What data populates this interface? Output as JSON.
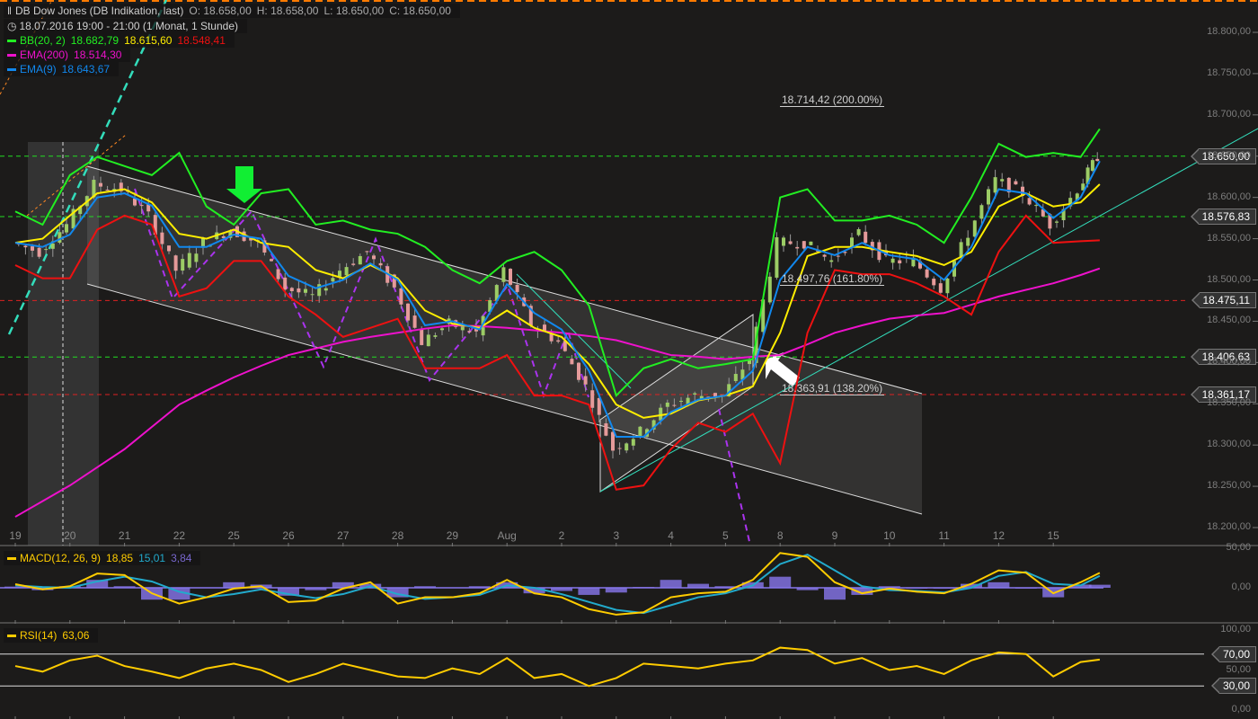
{
  "header": {
    "title": "DB Dow Jones (DB Indikation, last)",
    "ohlc": {
      "open": "O: 18.658,00",
      "high": "H: 18.658,00",
      "low": "L: 18.650,00",
      "close": "C: 18.650,00"
    },
    "period": "18.07.2016 19:00 - 21:00 (1 Monat, 1 Stunde)"
  },
  "indicators": {
    "bb": {
      "label": "BB(20, 2)",
      "upper": "18.682,79",
      "mid": "18.615,60",
      "lower": "18.548,41"
    },
    "ema200": {
      "label": "EMA(200)",
      "value": "18.514,30"
    },
    "ema9": {
      "label": "EMA(9)",
      "value": "18.643,67"
    },
    "macd": {
      "label": "MACD(12, 26, 9)",
      "macd": "18,85",
      "signal": "15,01",
      "hist": "3,84"
    },
    "rsi": {
      "label": "RSI(14)",
      "value": "63,06"
    }
  },
  "colors": {
    "bb_upper": "#22ee22",
    "bb_mid": "#ffee00",
    "bb_lower": "#ee1111",
    "ema200": "#ee11cc",
    "ema9": "#1188ee",
    "macd": "#ffcc00",
    "signal": "#22aacc",
    "hist": "#8877ee",
    "rsi": "#ffcc00",
    "up": "#9ccc65",
    "down": "#e59a9a"
  },
  "chart_data": {
    "type": "line",
    "title": "DB Dow Jones (DB Indikation, last) 1 Stunde",
    "x_unit": "trading day index (0 = 19 Jul)",
    "x": [
      0,
      0.5,
      1,
      1.5,
      2,
      2.5,
      3,
      3.5,
      4,
      4.5,
      5,
      5.5,
      6,
      6.5,
      7,
      7.5,
      8,
      8.5,
      9,
      9.5,
      10,
      10.5,
      11,
      11.5,
      12,
      12.5,
      13,
      13.5,
      14,
      14.5,
      15,
      15.5,
      16,
      16.5,
      17,
      17.5,
      18,
      18.5,
      19,
      19.5,
      19.85
    ],
    "x_ticks": [
      {
        "d": 0,
        "label": "19"
      },
      {
        "d": 1,
        "label": "20"
      },
      {
        "d": 2,
        "label": "21"
      },
      {
        "d": 3,
        "label": "22"
      },
      {
        "d": 4,
        "label": "25"
      },
      {
        "d": 5,
        "label": "26"
      },
      {
        "d": 6,
        "label": "27"
      },
      {
        "d": 7,
        "label": "28"
      },
      {
        "d": 8,
        "label": "29"
      },
      {
        "d": 9,
        "label": "Aug"
      },
      {
        "d": 10,
        "label": "2"
      },
      {
        "d": 11,
        "label": "3"
      },
      {
        "d": 12,
        "label": "4"
      },
      {
        "d": 13,
        "label": "5"
      },
      {
        "d": 14,
        "label": "8"
      },
      {
        "d": 15,
        "label": "9"
      },
      {
        "d": 16,
        "label": "10"
      },
      {
        "d": 17,
        "label": "11"
      },
      {
        "d": 18,
        "label": "12"
      },
      {
        "d": 19,
        "label": "15"
      }
    ],
    "price": {
      "ylim": [
        18200,
        18800
      ],
      "y_ticks": [
        "18.800,00",
        "18.750,00",
        "18.700,00",
        "18.650,00",
        "18.600,00",
        "18.550,00",
        "18.500,00",
        "18.450,00",
        "18.400,00",
        "18.350,00",
        "18.300,00",
        "18.250,00",
        "18.200,00"
      ],
      "y_tick_values": [
        18800,
        18750,
        18700,
        18650,
        18600,
        18550,
        18500,
        18450,
        18400,
        18350,
        18300,
        18250,
        18200
      ],
      "close": [
        18545,
        18534,
        18567,
        18616,
        18610,
        18578,
        18512,
        18545,
        18561,
        18545,
        18490,
        18480,
        18512,
        18534,
        18490,
        18425,
        18447,
        18436,
        18512,
        18447,
        18425,
        18371,
        18295,
        18316,
        18349,
        18360,
        18360,
        18404,
        18545,
        18545,
        18523,
        18556,
        18523,
        18523,
        18490,
        18556,
        18621,
        18605,
        18567,
        18610,
        18650
      ],
      "bb_upper": [
        18583,
        18567,
        18627,
        18649,
        18638,
        18627,
        18654,
        18589,
        18567,
        18605,
        18610,
        18567,
        18572,
        18561,
        18556,
        18540,
        18512,
        18496,
        18523,
        18534,
        18512,
        18469,
        18360,
        18393,
        18404,
        18393,
        18398,
        18404,
        18600,
        18610,
        18572,
        18572,
        18578,
        18567,
        18545,
        18600,
        18665,
        18649,
        18654,
        18649,
        18683
      ],
      "bb_mid": [
        18545,
        18550,
        18578,
        18605,
        18610,
        18594,
        18556,
        18550,
        18561,
        18545,
        18540,
        18512,
        18502,
        18518,
        18502,
        18463,
        18447,
        18442,
        18463,
        18442,
        18431,
        18398,
        18349,
        18333,
        18338,
        18354,
        18360,
        18371,
        18436,
        18529,
        18540,
        18540,
        18534,
        18529,
        18518,
        18534,
        18589,
        18605,
        18589,
        18594,
        18616
      ],
      "bb_lower": [
        18518,
        18502,
        18502,
        18561,
        18578,
        18567,
        18480,
        18490,
        18523,
        18523,
        18480,
        18458,
        18431,
        18442,
        18453,
        18393,
        18393,
        18393,
        18409,
        18360,
        18360,
        18349,
        18246,
        18251,
        18295,
        18327,
        18316,
        18338,
        18278,
        18436,
        18512,
        18507,
        18507,
        18496,
        18480,
        18458,
        18534,
        18578,
        18545,
        18547,
        18548
      ],
      "ema200": [
        18213,
        18232,
        18251,
        18273,
        18295,
        18322,
        18349,
        18366,
        18382,
        18396,
        18409,
        18417,
        18425,
        18431,
        18436,
        18441,
        18445,
        18444,
        18442,
        18439,
        18436,
        18432,
        18427,
        18418,
        18409,
        18407,
        18404,
        18407,
        18409,
        18422,
        18436,
        18445,
        18453,
        18457,
        18460,
        18470,
        18480,
        18488,
        18496,
        18506,
        18514
      ],
      "ema9": [
        18545,
        18540,
        18555,
        18600,
        18605,
        18590,
        18540,
        18540,
        18555,
        18550,
        18505,
        18490,
        18500,
        18520,
        18500,
        18445,
        18450,
        18440,
        18495,
        18460,
        18440,
        18390,
        18310,
        18310,
        18340,
        18355,
        18360,
        18390,
        18500,
        18540,
        18530,
        18545,
        18530,
        18525,
        18500,
        18540,
        18610,
        18605,
        18575,
        18600,
        18644
      ],
      "price_markers": [
        {
          "value": 18650.0,
          "label": "18.650,00",
          "style": "green-dashed"
        },
        {
          "value": 18576.83,
          "label": "18.576,83",
          "style": "green-dashed"
        },
        {
          "value": 18475.11,
          "label": "18.475,11",
          "style": "red-dashed"
        },
        {
          "value": 18406.63,
          "label": "18.406,63",
          "style": "green-dashed"
        },
        {
          "value": 18361.17,
          "label": "18.361,17",
          "style": "red-dashed"
        }
      ],
      "fib_labels": [
        {
          "value": 18714.42,
          "label": "18.714,42 (200.00%)"
        },
        {
          "value": 18497.76,
          "label": "18.497,76 (161.80%)"
        },
        {
          "value": 18363.91,
          "label": "18.363,91 (138.20%)"
        }
      ]
    },
    "macd_panel": {
      "ylim": [
        -40,
        55
      ],
      "y_ticks": [
        "50,00",
        "0,00"
      ],
      "y_tick_values": [
        50,
        0
      ],
      "macd": [
        4.5,
        -2,
        2,
        18,
        16,
        -7,
        -20,
        -12,
        -1,
        2,
        -18,
        -16,
        -1,
        7,
        -20,
        -12,
        -12,
        -7,
        10,
        -7,
        -12,
        -27,
        -34,
        -31,
        -12,
        -7,
        -5,
        10,
        44,
        39,
        7,
        -7,
        -1,
        -5,
        -7,
        5,
        22,
        19,
        -7,
        7,
        18.85
      ],
      "signal": [
        3,
        1,
        0,
        8,
        14,
        8,
        -5,
        -12,
        -8,
        -2,
        -8,
        -13,
        -8,
        2,
        -8,
        -14,
        -12,
        -9,
        3,
        0,
        -8,
        -18,
        -28,
        -32,
        -22,
        -12,
        -7,
        3,
        30,
        42,
        22,
        2,
        -3,
        -4,
        -6,
        0,
        15,
        20,
        5,
        3,
        15.01
      ]
    },
    "rsi_panel": {
      "ylim": [
        0,
        100
      ],
      "y_ticks": [
        "100,00",
        "50,00",
        "0,00"
      ],
      "y_tick_values": [
        100,
        50,
        0
      ],
      "levels": [
        {
          "value": 70,
          "label": "70,00"
        },
        {
          "value": 30,
          "label": "30,00"
        }
      ],
      "rsi": [
        55,
        48,
        62,
        68,
        55,
        48,
        40,
        52,
        58,
        50,
        35,
        45,
        58,
        50,
        42,
        40,
        52,
        45,
        65,
        40,
        45,
        30,
        40,
        58,
        55,
        52,
        58,
        62,
        78,
        75,
        58,
        65,
        50,
        55,
        45,
        62,
        72,
        70,
        42,
        60,
        63.06
      ]
    }
  }
}
